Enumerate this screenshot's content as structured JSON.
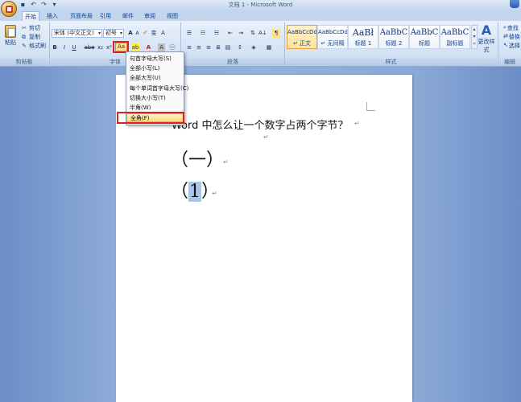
{
  "window": {
    "title": "文档 1 - Microsoft Word"
  },
  "quick_access": [
    {
      "icon": "save-icon",
      "glyph": "▪"
    },
    {
      "icon": "undo-icon",
      "glyph": "↶"
    },
    {
      "icon": "redo-icon",
      "glyph": "↷"
    },
    {
      "icon": "customize-icon",
      "glyph": "▾"
    }
  ],
  "tabs": [
    "开始",
    "插入",
    "页面布局",
    "引用",
    "邮件",
    "审阅",
    "视图"
  ],
  "clipboard": {
    "paste": "粘贴",
    "cut": "剪切",
    "copy": "复制",
    "format_painter": "格式刷",
    "group": "剪贴板"
  },
  "font": {
    "family": "宋体 (中文正文)",
    "size": "初号",
    "grow": "A",
    "shrink": "A",
    "group": "字体",
    "change_case": "Aa",
    "bold": "B",
    "italic": "I",
    "underline": "U",
    "strike": "abe",
    "subscript": "x₂",
    "superscript": "x²",
    "highlight": "ab",
    "font_color": "A",
    "char_shade": "A",
    "enclose": "㊀"
  },
  "paragraph": {
    "group": "段落"
  },
  "styles": {
    "group": "样式",
    "items": [
      {
        "sample": "AaBbCcDd",
        "name": "↵ 正文",
        "selected": true
      },
      {
        "sample": "AaBbCcDd",
        "name": "↵ 无间隔",
        "selected": false
      },
      {
        "sample": "AaBł",
        "name": "标题 1",
        "selected": false
      },
      {
        "sample": "AaBbC",
        "name": "标题 2",
        "selected": false
      },
      {
        "sample": "AaBbC",
        "name": "标题",
        "selected": false
      },
      {
        "sample": "AaBbC",
        "name": "副标题",
        "selected": false
      }
    ],
    "change_styles": "更改样式"
  },
  "editing": {
    "group": "编辑",
    "find": "查找",
    "replace": "替换",
    "select": "选择"
  },
  "case_menu": {
    "items": [
      "句首字母大写(S)",
      "全部小写(L)",
      "全部大写(U)",
      "每个单词首字母大写(C)",
      "切换大小写(T)",
      "半角(W)",
      "全角(F)"
    ],
    "hovered_index": 6
  },
  "document": {
    "heading": "Word 中怎么让一个数字占两个字节？",
    "line1": "（一）",
    "line2_open": "（",
    "line2_selected": "1",
    "line2_close": "）",
    "para_mark": "↵"
  },
  "colors": {
    "highlight_red": "#e02020",
    "selection": "#a9c6e8",
    "ribbon": "#d4e2f4"
  }
}
